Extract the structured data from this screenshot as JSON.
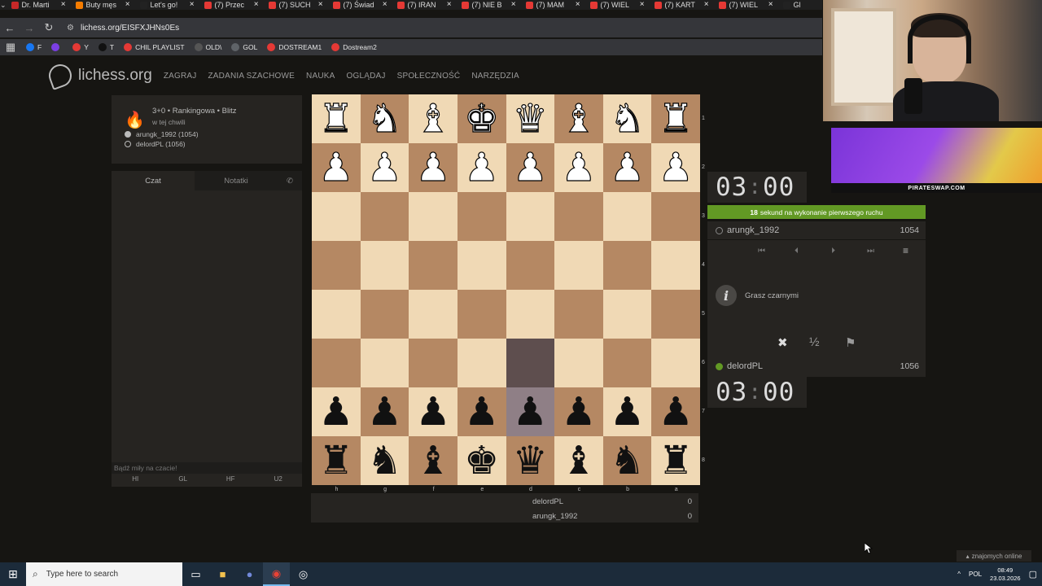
{
  "browser": {
    "tabs": [
      {
        "label": "Dr. Marti",
        "color": "#c62828"
      },
      {
        "label": "Buty męs",
        "color": "#f57c00"
      },
      {
        "label": "Let's go!",
        "color": "#222"
      },
      {
        "label": "(7) Przec",
        "color": "#e53935"
      },
      {
        "label": "(7) SUCH",
        "color": "#e53935"
      },
      {
        "label": "(7) Świad",
        "color": "#e53935"
      },
      {
        "label": "(7) IRAN",
        "color": "#e53935"
      },
      {
        "label": "(7) NIE B",
        "color": "#e53935"
      },
      {
        "label": "(7) MAM",
        "color": "#e53935"
      },
      {
        "label": "(7) WIEL",
        "color": "#e53935"
      },
      {
        "label": "(7) KART",
        "color": "#e53935"
      },
      {
        "label": "(7) WIEL",
        "color": "#e53935"
      },
      {
        "label": "Gl",
        "color": "#222"
      }
    ],
    "url": "lichess.org/EISFXJHNs0Es",
    "bookmarks": [
      {
        "label": "F",
        "color": "#1877f2"
      },
      {
        "label": "",
        "color": "#7b3fe4"
      },
      {
        "label": "Y",
        "color": "#e53935"
      },
      {
        "label": "T",
        "color": "#111"
      },
      {
        "label": "CHIL PLAYLIST",
        "color": "#e53935"
      },
      {
        "label": "OLD\\",
        "color": "#555"
      },
      {
        "label": "GOL",
        "color": "#5f6368"
      },
      {
        "label": "DOSTREAM1",
        "color": "#e53935"
      },
      {
        "label": "Dostream2",
        "color": "#e53935"
      }
    ]
  },
  "lichess": {
    "logo": "lichess.org",
    "nav": [
      "ZAGRAJ",
      "ZADANIA SZACHOWE",
      "NAUKA",
      "OGLĄDAJ",
      "SPOŁECZNOŚĆ",
      "NARZĘDZIA"
    ]
  },
  "game": {
    "type": "3+0 • Rankingowa • Blitz",
    "time": "w tej chwili",
    "white_player": "arungk_1992 (1054)",
    "black_player": "delordPL (1056)"
  },
  "chat": {
    "tab_chat": "Czat",
    "tab_notes": "Notatki",
    "placeholder": "Bądź miły na czacie!",
    "presets": [
      "HI",
      "GL",
      "HF",
      "U2"
    ]
  },
  "board": {
    "ranks": [
      "1",
      "2",
      "3",
      "4",
      "5",
      "6",
      "7",
      "8"
    ],
    "files": [
      "h",
      "g",
      "f",
      "e",
      "d",
      "c",
      "b",
      "a"
    ],
    "rows": [
      [
        "wR",
        "wN",
        "wB",
        "wK",
        "wQ",
        "wB",
        "wN",
        "wR"
      ],
      [
        "wP",
        "wP",
        "wP",
        "wP",
        "wP",
        "wP",
        "wP",
        "wP"
      ],
      [
        "",
        "",
        "",
        "",
        "",
        "",
        "",
        ""
      ],
      [
        "",
        "",
        "",
        "",
        "",
        "",
        "",
        ""
      ],
      [
        "",
        "",
        "",
        "",
        "",
        "",
        "",
        ""
      ],
      [
        "",
        "",
        "",
        "",
        "",
        "",
        "",
        ""
      ],
      [
        "bP",
        "bP",
        "bP",
        "bP",
        "bP",
        "bP",
        "bP",
        "bP"
      ],
      [
        "bR",
        "bN",
        "bB",
        "bK",
        "bQ",
        "bB",
        "bN",
        "bR"
      ]
    ]
  },
  "scores": [
    {
      "name": "delordPL",
      "score": "0"
    },
    {
      "name": "arungk_1992",
      "score": "0"
    }
  ],
  "panel": {
    "top_clock": {
      "min": "03",
      "sec": "00"
    },
    "first_move_secs": "18",
    "first_move_text": "sekund na wykonanie pierwszego ruchu",
    "top_player": {
      "name": "arungk_1992",
      "rating": "1054"
    },
    "info_text": "Grasz czarnymi",
    "bottom_player": {
      "name": "delordPL",
      "rating": "1056"
    },
    "bottom_clock": {
      "min": "03",
      "sec": "00"
    }
  },
  "overlays": {
    "ad_text": "PIRATESWAP.COM",
    "friends": "znajomych online"
  },
  "taskbar": {
    "search_placeholder": "Type here to search",
    "lang": "POL",
    "time": "08:49",
    "date": "23.03.2026"
  }
}
